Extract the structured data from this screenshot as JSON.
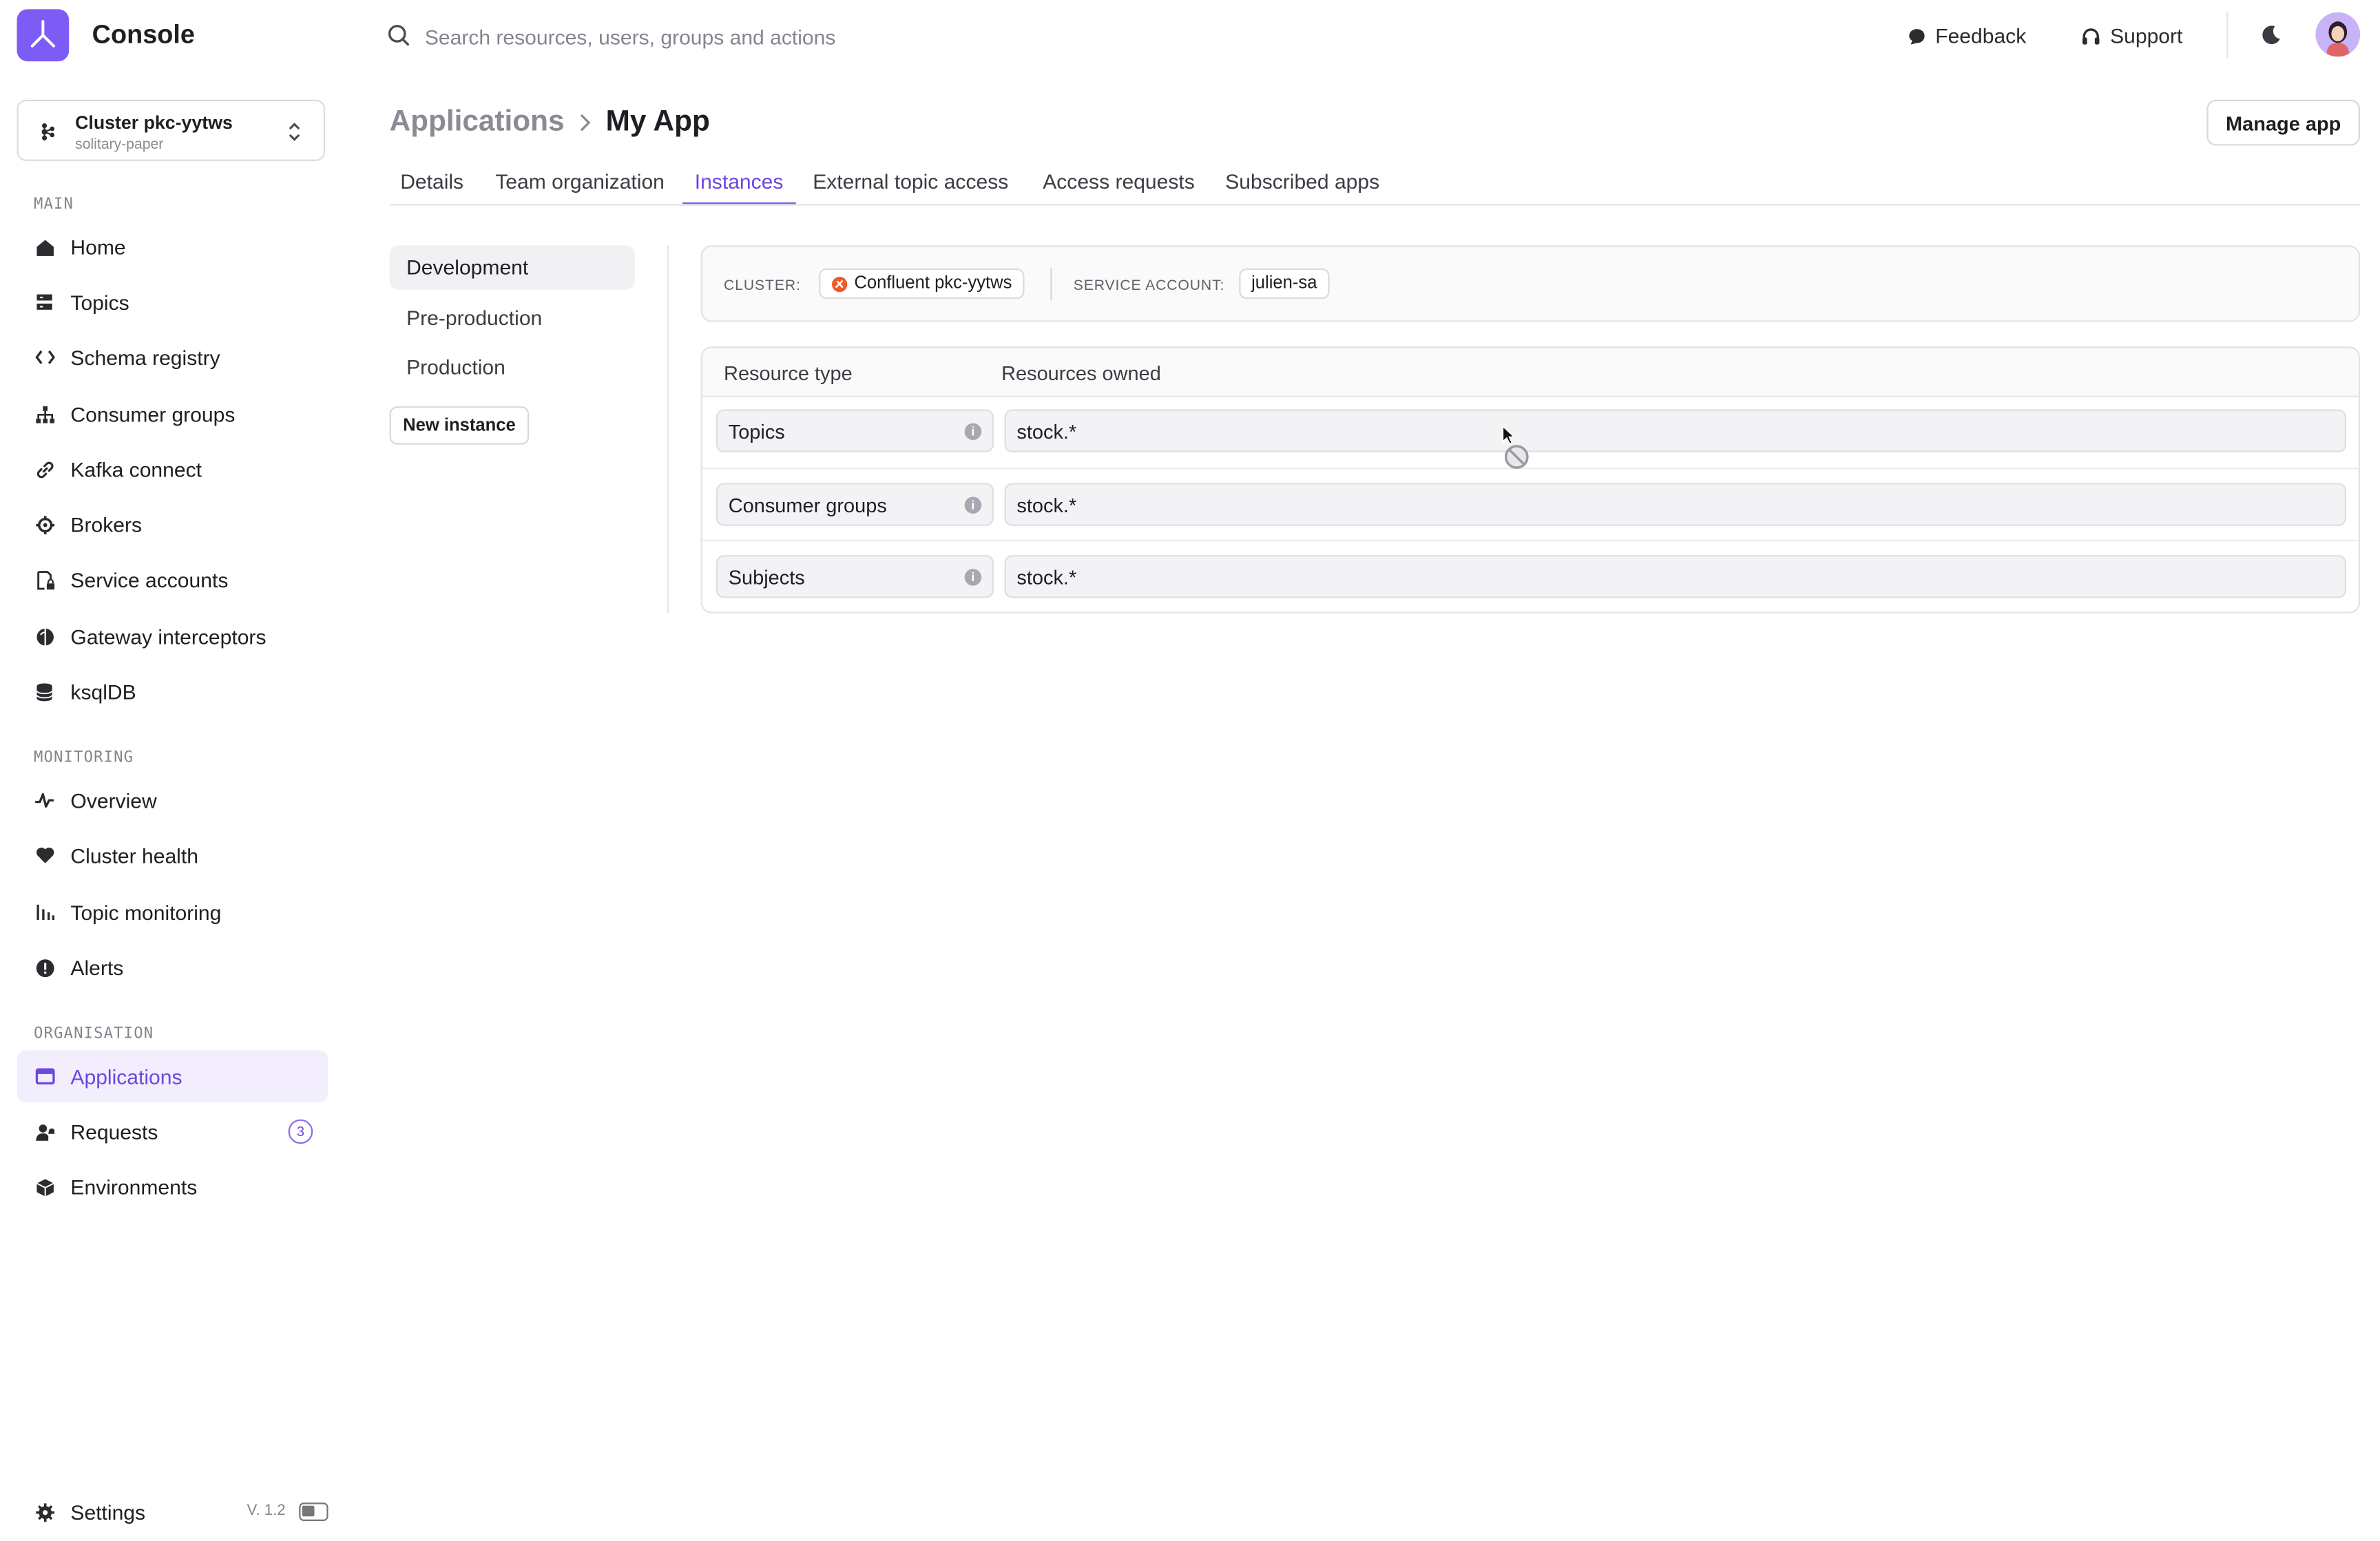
{
  "header": {
    "app_name": "Console",
    "search_placeholder": "Search resources, users, groups and actions",
    "feedback_label": "Feedback",
    "support_label": "Support"
  },
  "sidebar": {
    "cluster": {
      "name": "Cluster pkc-yytws",
      "subtitle": "solitary-paper"
    },
    "sections": {
      "main": "MAIN",
      "monitoring": "MONITORING",
      "organisation": "ORGANISATION"
    },
    "main_items": [
      "Home",
      "Topics",
      "Schema registry",
      "Consumer groups",
      "Kafka connect",
      "Brokers",
      "Service accounts",
      "Gateway interceptors",
      "ksqlDB"
    ],
    "monitoring_items": [
      "Overview",
      "Cluster health",
      "Topic monitoring",
      "Alerts"
    ],
    "organisation_items": [
      "Applications",
      "Requests",
      "Environments"
    ],
    "requests_count": "3",
    "settings_label": "Settings",
    "version": "V. 1.2"
  },
  "page": {
    "breadcrumb_parent": "Applications",
    "title": "My App",
    "manage_button": "Manage app",
    "tabs": [
      "Details",
      "Team organization",
      "Instances",
      "External topic access",
      "Access requests",
      "Subscribed apps"
    ],
    "active_tab": "Instances"
  },
  "instances": {
    "environments": [
      "Development",
      "Pre-production",
      "Production"
    ],
    "active_environment": "Development",
    "new_instance_button": "New instance",
    "cluster_label": "CLUSTER:",
    "cluster_value": "Confluent pkc-yytws",
    "service_account_label": "SERVICE ACCOUNT:",
    "service_account_value": "julien-sa",
    "table": {
      "headers": [
        "Resource type",
        "Resources owned"
      ],
      "rows": [
        {
          "type": "Topics",
          "value": "stock.*"
        },
        {
          "type": "Consumer groups",
          "value": "stock.*"
        },
        {
          "type": "Subjects",
          "value": "stock.*"
        }
      ]
    }
  },
  "colors": {
    "accent": "#7c5cf5",
    "active_text": "#6d46e0",
    "confluent_icon": "#f05a28"
  }
}
